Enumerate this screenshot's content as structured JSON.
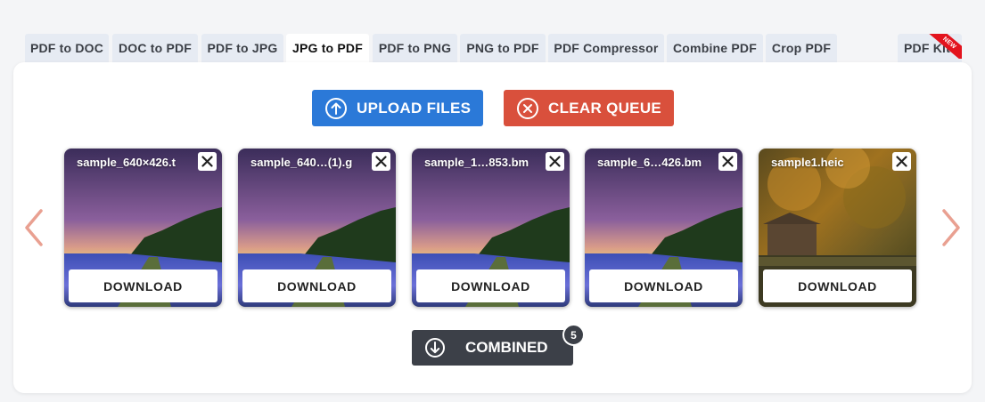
{
  "tabs": [
    {
      "label": "PDF to DOC"
    },
    {
      "label": "DOC to PDF"
    },
    {
      "label": "PDF to JPG"
    },
    {
      "label": "JPG to PDF"
    },
    {
      "label": "PDF to PNG"
    },
    {
      "label": "PNG to PDF"
    },
    {
      "label": "PDF Compressor"
    },
    {
      "label": "Combine PDF"
    },
    {
      "label": "Crop PDF"
    },
    {
      "label": "PDF Kit",
      "ribbon": "NEW"
    }
  ],
  "active_tab": "JPG to PDF",
  "toolbar": {
    "upload_label": "UPLOAD FILES",
    "clear_label": "CLEAR QUEUE"
  },
  "files": [
    {
      "name": "sample_640×426.t",
      "download_label": "DOWNLOAD",
      "thumbnail": "night-sky-lavender-field"
    },
    {
      "name": "sample_640…(1).g",
      "download_label": "DOWNLOAD",
      "thumbnail": "night-sky-lavender-field"
    },
    {
      "name": "sample_1…853.bm",
      "download_label": "DOWNLOAD",
      "thumbnail": "night-sky-lavender-field"
    },
    {
      "name": "sample_6…426.bm",
      "download_label": "DOWNLOAD",
      "thumbnail": "night-sky-lavender-field"
    },
    {
      "name": "sample1.heic",
      "download_label": "DOWNLOAD",
      "thumbnail": "autumn-forest-cabin"
    }
  ],
  "combined": {
    "label": "COMBINED",
    "count": "5"
  },
  "colors": {
    "upload": "#2b79d8",
    "clear": "#d9503c",
    "combined": "#3c4048",
    "tab_bg": "#e6ebf3",
    "arrow": "#e9a091",
    "ribbon": "#e3141e"
  },
  "icons": {
    "upload": "arrow-up-circle-icon",
    "clear": "x-circle-icon",
    "combined": "arrow-down-circle-icon",
    "nav_prev": "chevron-left-icon",
    "nav_next": "chevron-right-icon",
    "remove": "close-icon"
  }
}
